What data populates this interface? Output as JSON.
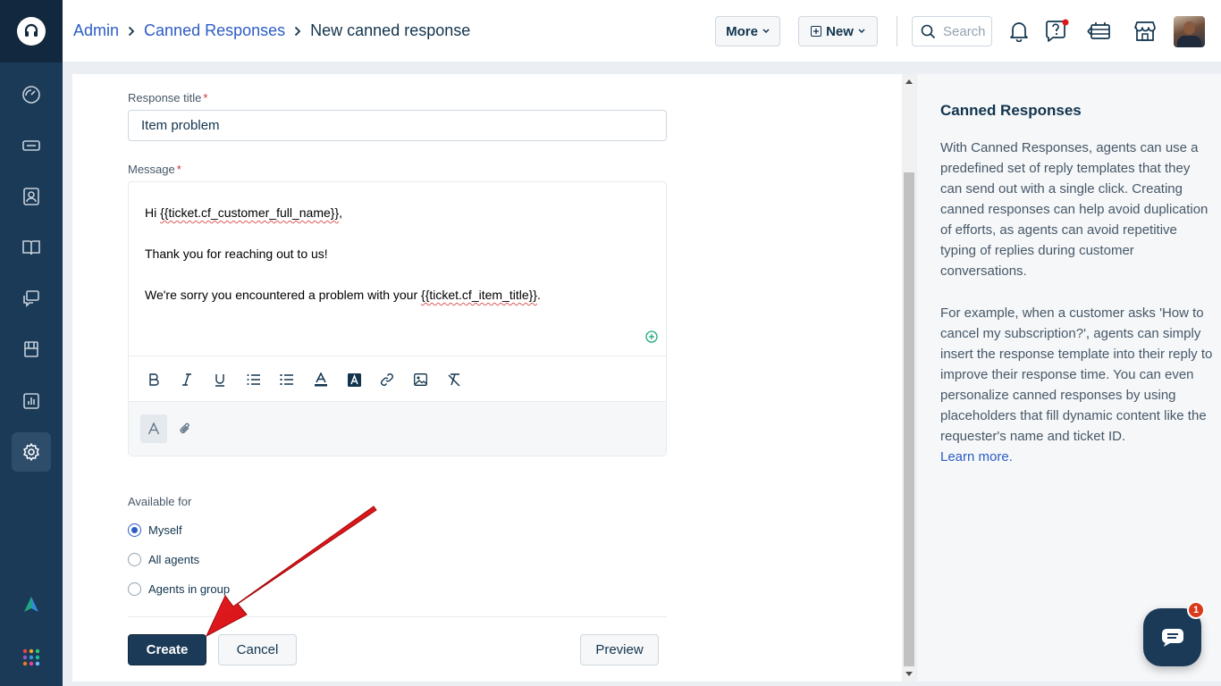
{
  "sidebar": {
    "items": [
      {
        "name": "dashboard",
        "icon": "gauge-icon"
      },
      {
        "name": "tickets",
        "icon": "ticket-icon"
      },
      {
        "name": "contacts",
        "icon": "contact-card-icon"
      },
      {
        "name": "solutions",
        "icon": "book-icon"
      },
      {
        "name": "forums",
        "icon": "chat-bubbles-icon"
      },
      {
        "name": "social",
        "icon": "ship-icon"
      },
      {
        "name": "reports",
        "icon": "bar-chart-icon"
      },
      {
        "name": "admin",
        "icon": "gear-icon",
        "active": true
      }
    ]
  },
  "header": {
    "breadcrumb": {
      "admin": "Admin",
      "canned": "Canned Responses",
      "current": "New canned response"
    },
    "more_label": "More",
    "new_label": "New",
    "search_placeholder": "Search"
  },
  "form": {
    "title_label": "Response title",
    "title_value": "Item problem",
    "message_label": "Message",
    "message": {
      "line1_pre": "Hi ",
      "line1_ph": "{{ticket.cf_customer_full_name}}",
      "line1_post": ",",
      "line2": "Thank you for reaching out to us!",
      "line3_pre": "We're sorry you encountered a problem with your ",
      "line3_ph": "{{ticket.cf_item_title}}",
      "line3_post": "."
    },
    "required_mark": "*",
    "available_label": "Available for",
    "options": [
      "Myself",
      "All agents",
      "Agents in group"
    ],
    "selected_option": "Myself",
    "create_label": "Create",
    "cancel_label": "Cancel",
    "preview_label": "Preview"
  },
  "info": {
    "title": "Canned Responses",
    "para1": "With Canned Responses, agents can use a predefined set of reply templates that they can send out with a single click. Creating canned responses can help avoid duplication of efforts, as agents can avoid repetitive typing of replies during customer conversations.",
    "para2": "For example, when a customer asks 'How to cancel my subscription?', agents can simply insert the response template into their reply to improve their response time. You can even personalize canned responses by using placeholders that fill dynamic content like the requester's name and ticket ID.",
    "learn_more": "Learn more."
  },
  "chat": {
    "badge": "1"
  },
  "colors": {
    "sidebar": "#1b3a57",
    "accent": "#2c5cc5",
    "primary_button": "#1b3a57",
    "required": "#d72d30",
    "annotation_arrow": "#e0161b"
  }
}
